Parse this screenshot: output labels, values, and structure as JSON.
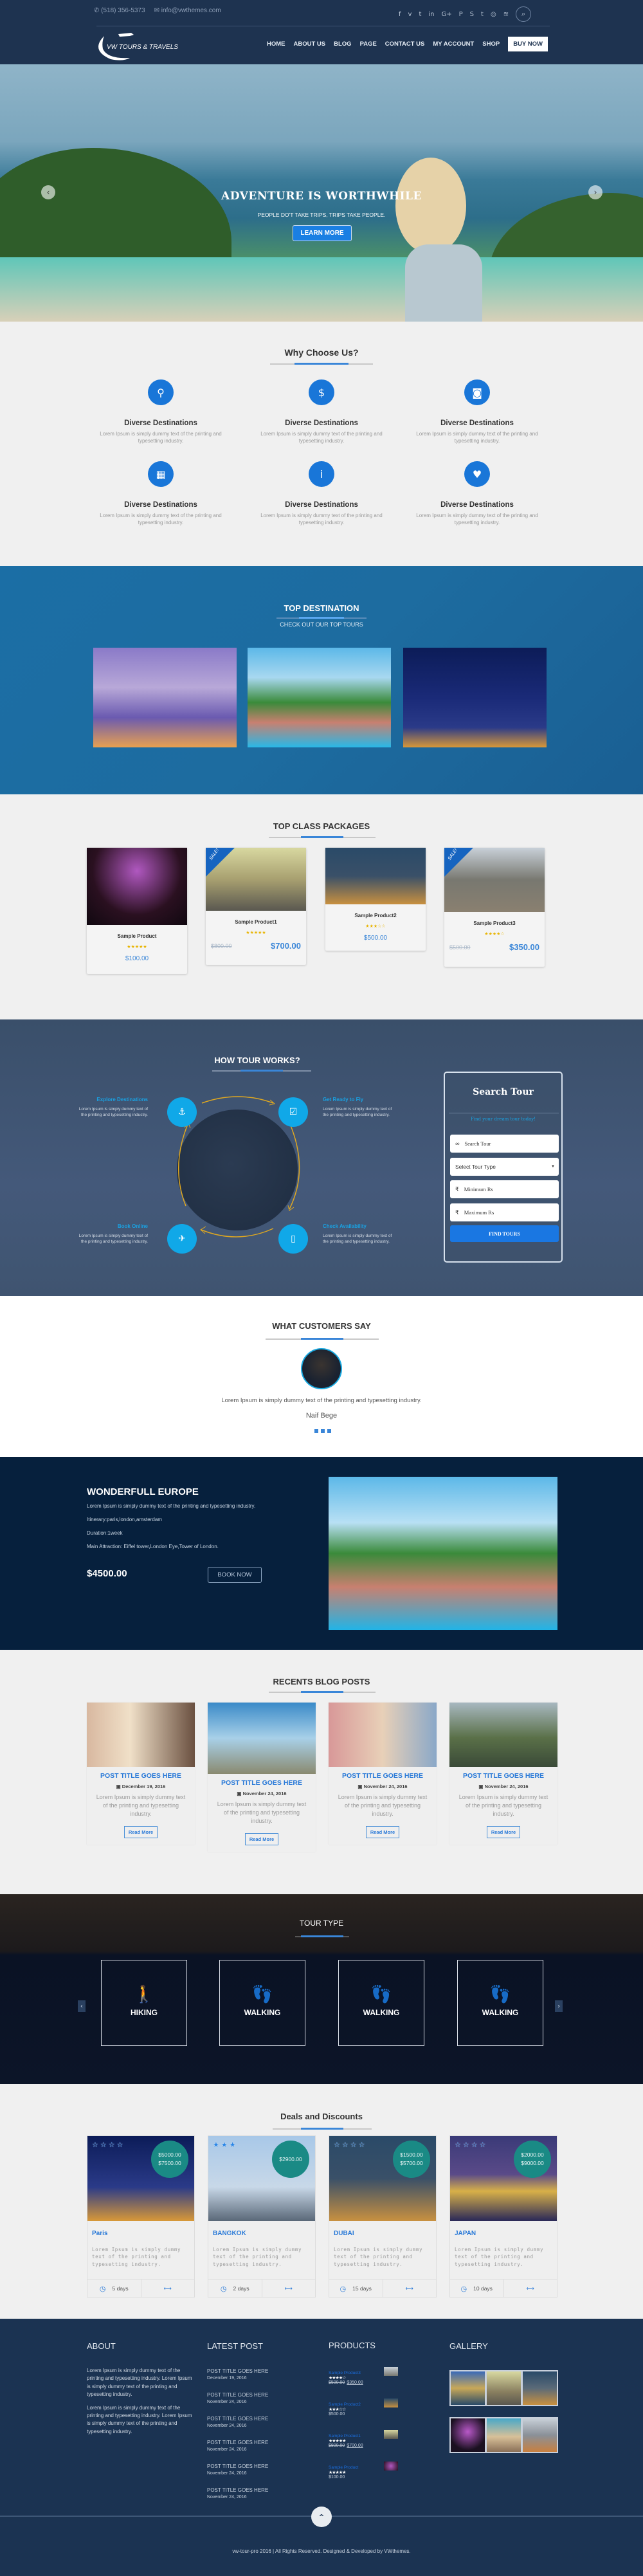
{
  "header": {
    "phone": "(518) 356-5373",
    "email": "info@vwthemes.com",
    "social_icons": [
      "facebook-icon",
      "vimeo-icon",
      "twitter-icon",
      "linkedin-icon",
      "google-plus-icon",
      "pinterest-icon",
      "skype-icon",
      "tumblr-icon",
      "instagram-icon",
      "rss-icon"
    ],
    "social_glyphs": [
      "f",
      "v",
      "t",
      "in",
      "G+",
      "P",
      "S",
      "t",
      "◎",
      "≋"
    ],
    "logo_text": "VW TOURS & TRAVELS",
    "nav": [
      "HOME",
      "ABOUT US",
      "BLOG",
      "PAGE",
      "CONTACT US",
      "MY ACCOUNT",
      "SHOP"
    ],
    "buy_now": "BUY NOW"
  },
  "hero": {
    "title": "ADVENTURE IS WORTHWHILE",
    "subtitle": "PEOPLE DO'T TAKE TRIPS, TRIPS TAKE PEOPLE.",
    "cta": "LEARN MORE",
    "slide_count": 4
  },
  "why": {
    "title": "Why Choose Us?",
    "items": [
      {
        "icon": "map-pin-icon",
        "glyph": "⚲",
        "title": "Diverse Destinations",
        "text": "Lorem Ipsum is simply dummy text of the printing and typesetting industry."
      },
      {
        "icon": "money-bag-icon",
        "glyph": "$",
        "title": "Diverse Destinations",
        "text": "Lorem Ipsum is simply dummy text of the printing and typesetting industry."
      },
      {
        "icon": "camera-icon",
        "glyph": "◙",
        "title": "Diverse Destinations",
        "text": "Lorem Ipsum is simply dummy text of the printing and typesetting industry."
      },
      {
        "icon": "calendar-icon",
        "glyph": "▦",
        "title": "Diverse Destinations",
        "text": "Lorem Ipsum is simply dummy text of the printing and typesetting industry."
      },
      {
        "icon": "info-icon",
        "glyph": "i",
        "title": "Diverse Destinations",
        "text": "Lorem Ipsum is simply dummy text of the printing and typesetting industry."
      },
      {
        "icon": "heart-icon",
        "glyph": "♥",
        "title": "Diverse Destinations",
        "text": "Lorem Ipsum is simply dummy text of the printing and typesetting industry."
      }
    ]
  },
  "top_destination": {
    "title": "TOP DESTINATION",
    "subtitle": "CHECK OUT OUR TOP TOURS"
  },
  "packages": {
    "title": "TOP CLASS PACKAGES",
    "items": [
      {
        "name": "Sample Product",
        "rating": 5,
        "stars": "★★★★★",
        "price": "$100.00",
        "old_price": null,
        "sale": false
      },
      {
        "name": "Sample Product1",
        "rating": 5,
        "stars": "★★★★★",
        "price": "$700.00",
        "old_price": "$800.00",
        "sale": true,
        "sale_label": "SALE!"
      },
      {
        "name": "Sample Product2",
        "rating": 3,
        "stars": "★★★☆☆",
        "price": "$500.00",
        "old_price": null,
        "sale": false
      },
      {
        "name": "Sample Product3",
        "rating": 4,
        "stars": "★★★★☆",
        "price": "$350.00",
        "old_price": "$500.00",
        "sale": true,
        "sale_label": "SALE!"
      }
    ]
  },
  "how": {
    "title": "HOW TOUR WORKS?",
    "steps": [
      {
        "title": "Explore Destinations",
        "text": "Lorem Ipsum is simply dummy text of the printing and typesetting industry.",
        "icon": "anchor-icon",
        "glyph": "⚓"
      },
      {
        "title": "Get Ready to Fly",
        "text": "Lorem Ipsum is simply dummy text of the printing and typesetting industry.",
        "icon": "calendar-check-icon",
        "glyph": "☑"
      },
      {
        "title": "Book Online",
        "text": "Lorem Ipsum is simply dummy text of the printing and typesetting industry.",
        "icon": "plane-icon",
        "glyph": "✈"
      },
      {
        "title": "Check Availability",
        "text": "Lorem Ipsum is simply dummy text of the printing and typesetting industry.",
        "icon": "document-icon",
        "glyph": "▯"
      }
    ]
  },
  "search": {
    "title": "Search Tour",
    "subtitle": "Find your dream tour today!",
    "search_placeholder": "Search Tour",
    "tour_type_selected": "Select Tour Type",
    "min_placeholder": "Minimum Rs",
    "max_placeholder": "Maximum Rs",
    "currency_glyph": "₹",
    "button": "FIND TOURS"
  },
  "testimonials": {
    "title": "WHAT CUSTOMERS SAY",
    "quote": "Lorem Ipsum is simply dummy text of the printing and typesetting industry.",
    "name": "Naif Bege",
    "slide_count": 3
  },
  "featured": {
    "title": "WONDERFULL EUROPE",
    "description": "Lorem Ipsum is simply dummy text of the printing and typesetting industry.",
    "itinerary": "Itinerary:paris,london,amsterdam",
    "duration": "Duration:1week",
    "attractions": "Main Attraction: Eiffel tower,London Eye,Tower of London.",
    "price": "$4500.00",
    "button": "BOOK NOW"
  },
  "blog": {
    "title": "RECENTS BLOG POSTS",
    "posts": [
      {
        "title": "POST TITLE GOES HERE",
        "date": "December 19, 2016",
        "excerpt": "Lorem Ipsum is simply dummy text of the printing and typesetting industry.",
        "button": "Read More"
      },
      {
        "title": "POST TITLE GOES HERE",
        "date": "November 24, 2016",
        "excerpt": "Lorem Ipsum is simply dummy text of the printing and typesetting industry.",
        "button": "Read More"
      },
      {
        "title": "POST TITLE GOES HERE",
        "date": "November 24, 2016",
        "excerpt": "Lorem Ipsum is simply dummy text of the printing and typesetting industry.",
        "button": "Read More"
      },
      {
        "title": "POST TITLE GOES HERE",
        "date": "November 24, 2016",
        "excerpt": "Lorem Ipsum is simply dummy text of the printing and typesetting industry.",
        "button": "Read More"
      }
    ]
  },
  "tour_type": {
    "title": "TOUR TYPE",
    "items": [
      {
        "label": "HIKING",
        "icon": "hiker-icon",
        "glyph": "🚶"
      },
      {
        "label": "WALKING",
        "icon": "footprints-icon",
        "glyph": "👣"
      },
      {
        "label": "WALKING",
        "icon": "footprints-icon",
        "glyph": "👣"
      },
      {
        "label": "WALKING",
        "icon": "footprints-icon",
        "glyph": "👣"
      }
    ],
    "prev": "‹",
    "next": "›"
  },
  "deals": {
    "title": "Deals and Discounts",
    "items": [
      {
        "name": "Paris",
        "stars": "☆☆☆☆",
        "rating": 4,
        "prices": [
          "$5000.00",
          "$7500.00"
        ],
        "text": "Lorem Ipsum is simply dummy text of the printing and typesetting industry.",
        "duration": "5 days"
      },
      {
        "name": "BANGKOK",
        "stars": "★★★",
        "rating": 3,
        "prices": [
          "$2900.00"
        ],
        "text": "Lorem Ipsum is simply dummy text of the printing and typesetting industry.",
        "duration": "2 days"
      },
      {
        "name": "DUBAI",
        "stars": "☆☆☆☆",
        "rating": 4,
        "prices": [
          "$1500.00",
          "$5700.00"
        ],
        "text": "Lorem Ipsum is simply dummy text of the printing and typesetting industry.",
        "duration": "15 days"
      },
      {
        "name": "JAPAN",
        "stars": "☆☆☆☆",
        "rating": 4,
        "prices": [
          "$2000.00",
          "$9000.00"
        ],
        "text": "Lorem Ipsum is simply dummy text of the printing and typesetting industry.",
        "duration": "10 days"
      }
    ]
  },
  "footer": {
    "about_title": "ABOUT",
    "about_p1": "Lorem Ipsum is simply dummy text of the printing and typesetting industry. Lorem Ipsum is simply dummy text of the printing and typesetting industry.",
    "about_p2": "Lorem Ipsum is simply dummy text of the printing and typesetting industry. Lorem Ipsum is simply dummy text of the printing and typesetting industry.",
    "latest_title": "LATEST POST",
    "latest": [
      {
        "title": "POST TITLE GOES HERE",
        "date": "December 19, 2016"
      },
      {
        "title": "POST TITLE GOES HERE",
        "date": "November 24, 2016"
      },
      {
        "title": "POST TITLE GOES HERE",
        "date": "November 24, 2016"
      },
      {
        "title": "POST TITLE GOES HERE",
        "date": "November 24, 2016"
      },
      {
        "title": "POST TITLE GOES HERE",
        "date": "November 24, 2016"
      },
      {
        "title": "POST TITLE GOES HERE",
        "date": "November 24, 2016"
      }
    ],
    "products_title": "PRODUCTS",
    "products": [
      {
        "name": "Sample Product3",
        "stars": "★★★★☆",
        "old_price": "$500.00",
        "price": "$350.00"
      },
      {
        "name": "Sample Product2",
        "stars": "★★★☆☆",
        "old_price": "",
        "price": "$500.00"
      },
      {
        "name": "Sample Product1",
        "stars": "★★★★★",
        "old_price": "$800.00",
        "price": "$700.00"
      },
      {
        "name": "Sample Product",
        "stars": "★★★★★",
        "old_price": "",
        "price": "$100.00"
      }
    ],
    "gallery_title": "GALLERY",
    "copyright": "vw-tour-pro 2016 | All Rights Reserved. Designed & Developed by VWthemes.",
    "back_to_top": "^"
  }
}
